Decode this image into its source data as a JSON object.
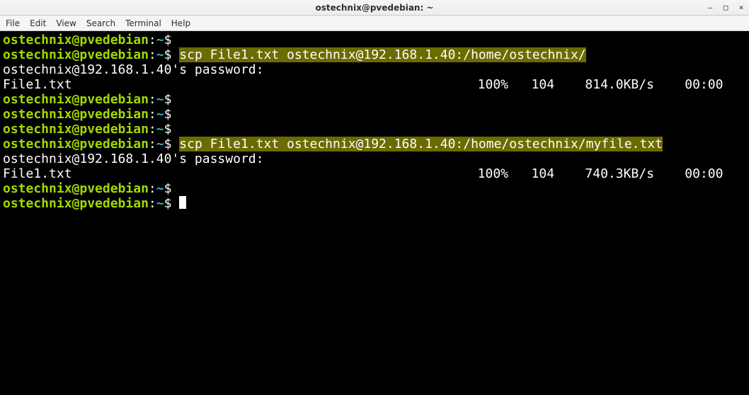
{
  "titlebar": {
    "title": "ostechnix@pvedebian: ~",
    "buttons": {
      "minimize": "–",
      "maximize": "□",
      "close": "×"
    }
  },
  "menubar": [
    "File",
    "Edit",
    "View",
    "Search",
    "Terminal",
    "Help"
  ],
  "prompt": {
    "user_host": "ostechnix@pvedebian",
    "path": "~",
    "symbol": "$"
  },
  "lines": [
    {
      "kind": "prompt",
      "cmd": ""
    },
    {
      "kind": "prompt_hl",
      "cmd": "scp File1.txt ostechnix@192.168.1.40:/home/ostechnix/"
    },
    {
      "kind": "text",
      "text": "ostechnix@192.168.1.40's password:"
    },
    {
      "kind": "progress",
      "file": "File1.txt",
      "pct": "100%",
      "size": "104",
      "speed": "814.0KB/s",
      "eta": "00:00"
    },
    {
      "kind": "prompt",
      "cmd": ""
    },
    {
      "kind": "prompt",
      "cmd": ""
    },
    {
      "kind": "prompt",
      "cmd": ""
    },
    {
      "kind": "prompt_hl",
      "cmd": "scp File1.txt ostechnix@192.168.1.40:/home/ostechnix/myfile.txt"
    },
    {
      "kind": "text",
      "text": "ostechnix@192.168.1.40's password:"
    },
    {
      "kind": "progress",
      "file": "File1.txt",
      "pct": "100%",
      "size": "104",
      "speed": "740.3KB/s",
      "eta": "00:00"
    },
    {
      "kind": "prompt",
      "cmd": ""
    },
    {
      "kind": "prompt_cursor",
      "cmd": ""
    }
  ],
  "sep": {
    "colon": ":",
    "space": " ",
    "gap": "   ",
    "biggap": "    "
  }
}
